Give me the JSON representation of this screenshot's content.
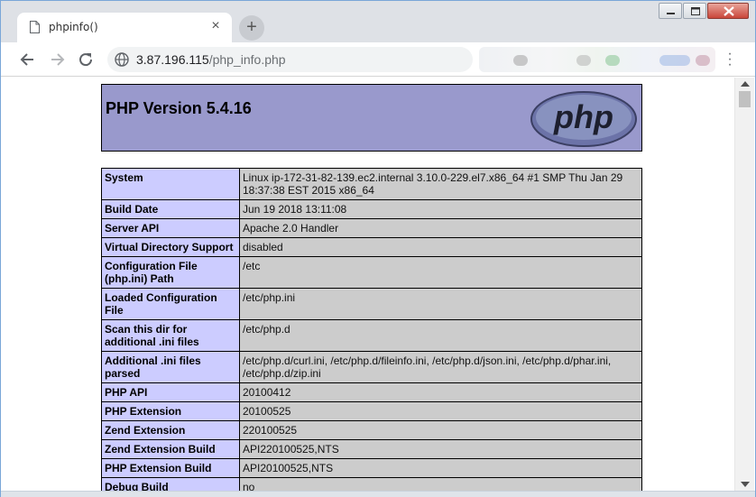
{
  "browser": {
    "tab_title": "phpinfo()",
    "new_tab_label": "+",
    "url_host": "3.87.196.115",
    "url_path": "/php_info.php",
    "colors": {
      "titlebar": "#dee1e6",
      "header_bg": "#9999cc",
      "key_bg": "#ccccff",
      "value_bg": "#cccccc"
    }
  },
  "page": {
    "heading": "PHP Version 5.4.16",
    "logo_text": "php",
    "rows": [
      {
        "key": "System",
        "value": "Linux ip-172-31-82-139.ec2.internal 3.10.0-229.el7.x86_64 #1 SMP Thu Jan 29 18:37:38 EST 2015 x86_64"
      },
      {
        "key": "Build Date",
        "value": "Jun 19 2018 13:11:08"
      },
      {
        "key": "Server API",
        "value": "Apache 2.0 Handler"
      },
      {
        "key": "Virtual Directory Support",
        "value": "disabled"
      },
      {
        "key": "Configuration File (php.ini) Path",
        "value": "/etc"
      },
      {
        "key": "Loaded Configuration File",
        "value": "/etc/php.ini"
      },
      {
        "key": "Scan this dir for additional .ini files",
        "value": "/etc/php.d"
      },
      {
        "key": "Additional .ini files parsed",
        "value": "/etc/php.d/curl.ini, /etc/php.d/fileinfo.ini, /etc/php.d/json.ini, /etc/php.d/phar.ini, /etc/php.d/zip.ini"
      },
      {
        "key": "PHP API",
        "value": "20100412"
      },
      {
        "key": "PHP Extension",
        "value": "20100525"
      },
      {
        "key": "Zend Extension",
        "value": "220100525"
      },
      {
        "key": "Zend Extension Build",
        "value": "API220100525,NTS"
      },
      {
        "key": "PHP Extension Build",
        "value": "API20100525,NTS"
      },
      {
        "key": "Debug Build",
        "value": "no"
      }
    ]
  }
}
